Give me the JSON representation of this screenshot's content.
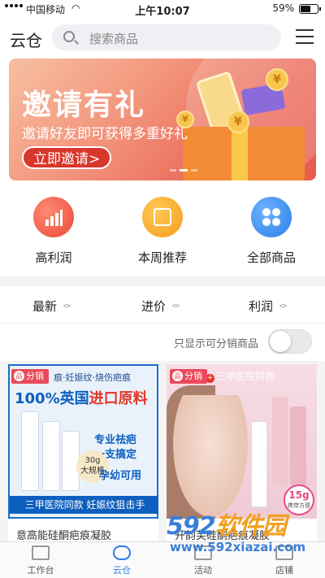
{
  "status_bar": {
    "carrier": "中国移动",
    "time": "上午10:07",
    "battery": "59%"
  },
  "header": {
    "title": "云仓",
    "search_placeholder": "搜索商品"
  },
  "banner": {
    "headline": "邀请有礼",
    "subtitle": "邀请好友即可获得多重好礼",
    "cta": "立即邀请>",
    "coin_symbol": "¥"
  },
  "quick_entries": [
    {
      "label": "高利润",
      "icon": "chart-up-icon",
      "color": "#ea4a3a"
    },
    {
      "label": "本周推荐",
      "icon": "shopping-bag-icon",
      "color": "#f59a1f"
    },
    {
      "label": "全部商品",
      "icon": "clover-grid-icon",
      "color": "#2a7fe8"
    }
  ],
  "sort_options": [
    {
      "label": "最新"
    },
    {
      "label": "进价"
    },
    {
      "label": "利润"
    }
  ],
  "filter": {
    "label": "只显示可分销商品",
    "enabled": false
  },
  "products": [
    {
      "tag": "分销",
      "img_top": "痕·妊娠纹·烧伤疤痕",
      "img_headline_a": "100%英国",
      "img_headline_b": "进口原料",
      "img_line1": "专业祛疤",
      "img_line2": "一支搞定",
      "img_line3": "孕幼可用",
      "img_badge_a": "30g",
      "img_badge_b": "大规格",
      "img_footer": "三甲医院同款 妊娠纹狙击手",
      "name": "意高能硅酮疤痕凝胶"
    },
    {
      "tag": "分销",
      "img_top": "三甲医院同款",
      "img_badge_a": "15g",
      "img_badge_b": "携带方便",
      "name": "开韵芙硅酮疤痕凝胶"
    }
  ],
  "tabbar": [
    {
      "label": "工作台",
      "active": false
    },
    {
      "label": "云仓",
      "active": true
    },
    {
      "label": "活动",
      "active": false
    },
    {
      "label": "店铺",
      "active": false
    }
  ],
  "watermark": {
    "logo_a": "592",
    "logo_b": "软件园",
    "url": "www.592xiazai.com"
  }
}
